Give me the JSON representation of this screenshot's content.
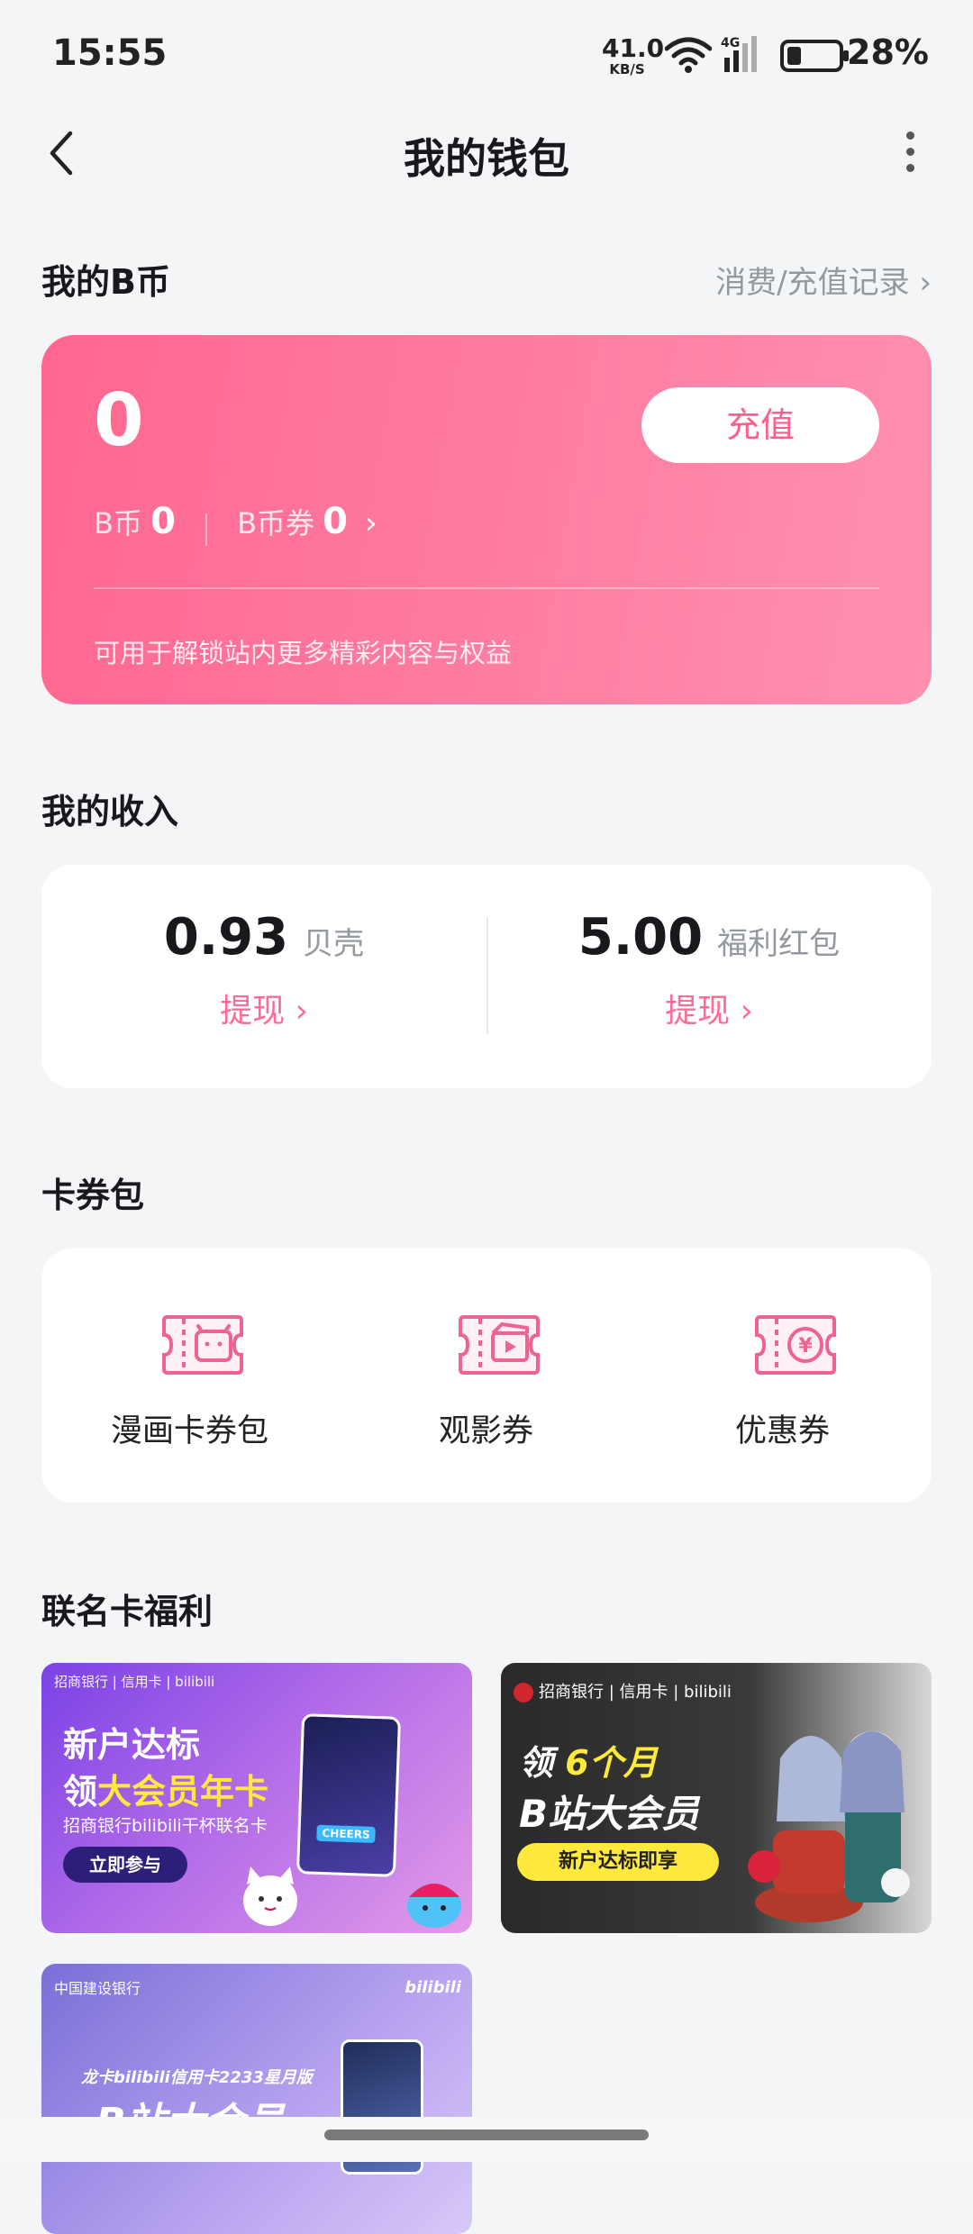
{
  "status_bar": {
    "time": "15:55",
    "net_speed": "41.0",
    "net_unit": "KB/S",
    "signal": "4G",
    "battery_pct": "28%",
    "battery_level": 0.28
  },
  "nav": {
    "title": "我的钱包"
  },
  "bcoin": {
    "section_title": "我的B币",
    "records_link": "消费/充值记录",
    "total": "0",
    "recharge_label": "充值",
    "bcoin_label": "B币",
    "bcoin_value": "0",
    "coupon_label": "B币券",
    "coupon_value": "0",
    "description": "可用于解锁站内更多精彩内容与权益",
    "gradient_start": "#ff6690",
    "gradient_end": "#ff90b0"
  },
  "income": {
    "section_title": "我的收入",
    "items": [
      {
        "value": "0.93",
        "unit": "贝壳",
        "action": "提现"
      },
      {
        "value": "5.00",
        "unit": "福利红包",
        "action": "提现"
      }
    ],
    "accent_color": "#ff6a96"
  },
  "vouchers": {
    "section_title": "卡券包",
    "items": [
      {
        "label": "漫画卡券包",
        "icon": "comic-ticket-icon"
      },
      {
        "label": "观影券",
        "icon": "movie-ticket-icon"
      },
      {
        "label": "优惠券",
        "icon": "discount-ticket-icon"
      }
    ]
  },
  "cobrand": {
    "section_title": "联名卡福利",
    "banners": [
      {
        "bank": "招商银行 | 信用卡 | bilibili",
        "line1": "新户达标",
        "line2a": "领",
        "line2b": "大会员年卡",
        "sub": "招商银行bilibili干杯联名卡",
        "button": "立即参与",
        "card_text": "CHEERS"
      },
      {
        "bank": "招商银行 | 信用卡 | bilibili",
        "line1a": "领",
        "line1b": "6个月",
        "line2": "B站大会员",
        "pill": "新户达标即享"
      },
      {
        "bank": "中国建设银行",
        "logo": "bilibili",
        "line1": "龙卡bilibili信用卡2233星月版",
        "line2": "B站大会员"
      }
    ]
  }
}
